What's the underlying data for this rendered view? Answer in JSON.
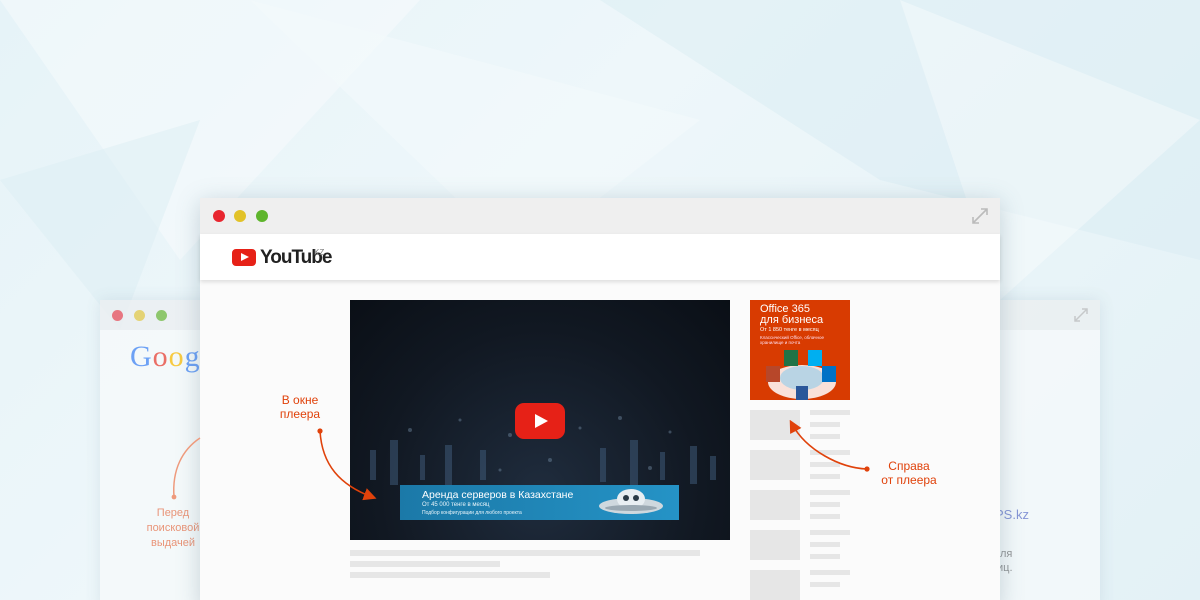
{
  "colors": {
    "accent": "#e0420b",
    "youtube_red": "#e62117",
    "office_orange": "#d83b01",
    "banner_blue": "#1b79a8"
  },
  "main_window": {
    "brand": {
      "icon": "youtube-play-icon",
      "name": "YouTube",
      "region": "KZ"
    },
    "expand_icon": "expand-icon",
    "player": {
      "play_icon": "play-icon",
      "banner": {
        "title": "Аренда серверов в Казахстане",
        "line2": "От 45 000 тенге в месяц",
        "line3": "Подбор конфигурации для любого проекта"
      }
    },
    "side_ad": {
      "title_line1": "Office 365",
      "title_line2": "для бизнеса",
      "price": "От 1 850 тенге в месяц",
      "details": "Классический Office, облачное хранилище и почта"
    }
  },
  "labels": {
    "in_player_1": "В окне",
    "in_player_2": "плеера",
    "right_1": "Справа",
    "right_2": "от плеера",
    "before_search_1": "Перед",
    "before_search_2": "поисковой",
    "before_search_3": "выдачей"
  },
  "back_left": {
    "logo": "Goog"
  },
  "back_right": {
    "brand_fragment": "PS.kz",
    "text_1": "ля",
    "text_2": "иц."
  }
}
